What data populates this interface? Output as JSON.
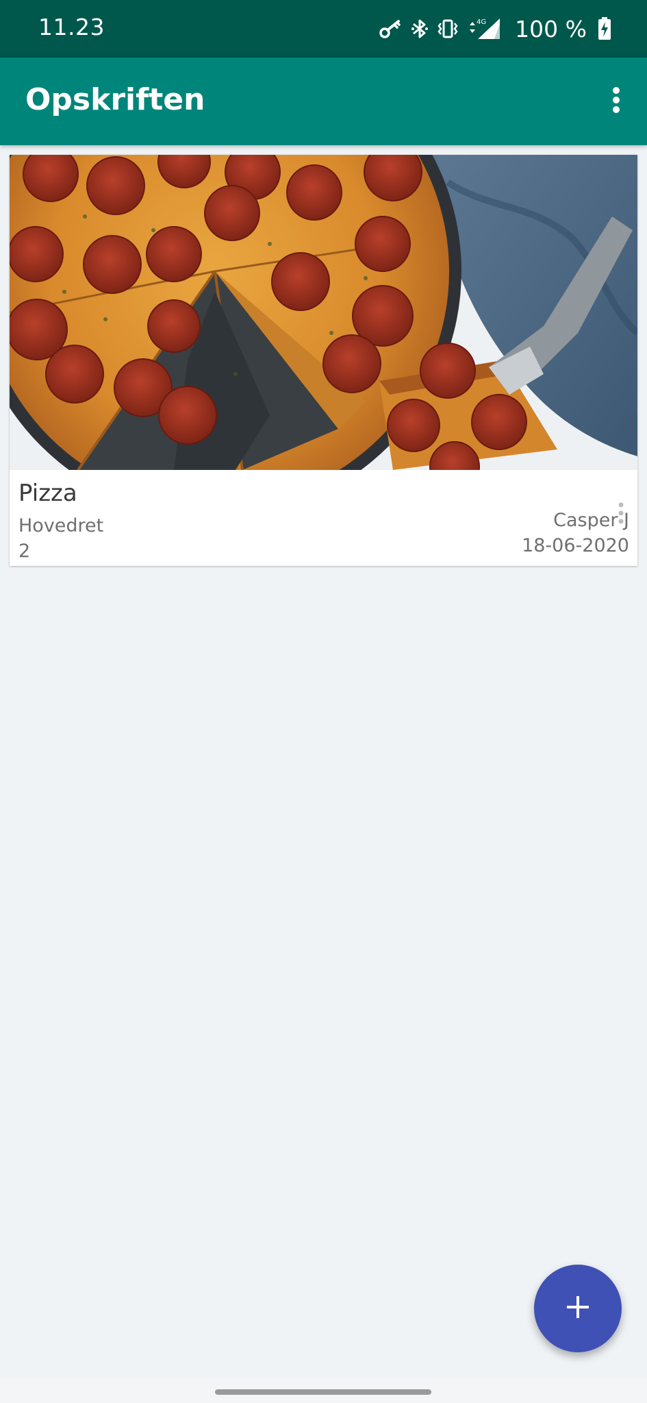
{
  "status_bar": {
    "time": "11.23",
    "battery": "100 %",
    "icons": [
      "key-icon",
      "bluetooth-icon",
      "vibrate-icon",
      "network-4g-icon",
      "signal-icon",
      "battery-charging-icon"
    ],
    "network_label": "4G"
  },
  "app_bar": {
    "title": "Opskriften",
    "menu_icon": "more-vert-icon"
  },
  "recipes": [
    {
      "title": "Pizza",
      "category": "Hovedret",
      "servings": "2",
      "author": "Casper J",
      "date": "18-06-2020",
      "image": "pepperoni-pizza-photo"
    }
  ],
  "fab": {
    "icon": "add-icon"
  },
  "colors": {
    "status_bar": "#00574b",
    "app_bar": "#00857a",
    "background": "#f0f3f6",
    "fab": "#3f51b5",
    "card": "#ffffff"
  }
}
